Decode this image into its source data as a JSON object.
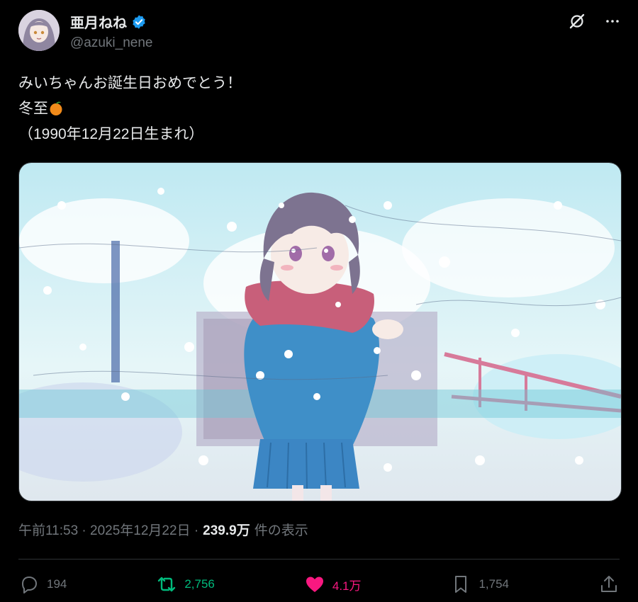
{
  "author": {
    "display_name": "亜月ねね",
    "handle": "@azuki_nene",
    "verified": true
  },
  "tweet": {
    "line1": "みいちゃんお誕生日おめでとう！",
    "line2": "冬至",
    "line3": "（1990年12月22日生まれ）"
  },
  "meta": {
    "time": "午前11:53 · 2025年12月22日 ·",
    "views": "239.9万",
    "views_suffix": "件の表示"
  },
  "actions": {
    "replies": "194",
    "retweets": "2,756",
    "likes": "4.1万",
    "bookmarks": "1,754"
  },
  "icons": {
    "top": [
      "grok-icon",
      "more-icon"
    ],
    "actions": [
      "reply-icon",
      "retweet-icon",
      "like-icon",
      "bookmark-icon",
      "share-icon"
    ],
    "emoji": "orange-emoji"
  },
  "colors": {
    "background": "#000000",
    "text": "#e7e9ea",
    "muted": "#71767b",
    "retweet": "#00ba7c",
    "like": "#f91880",
    "verified": "#1d9bf0"
  }
}
